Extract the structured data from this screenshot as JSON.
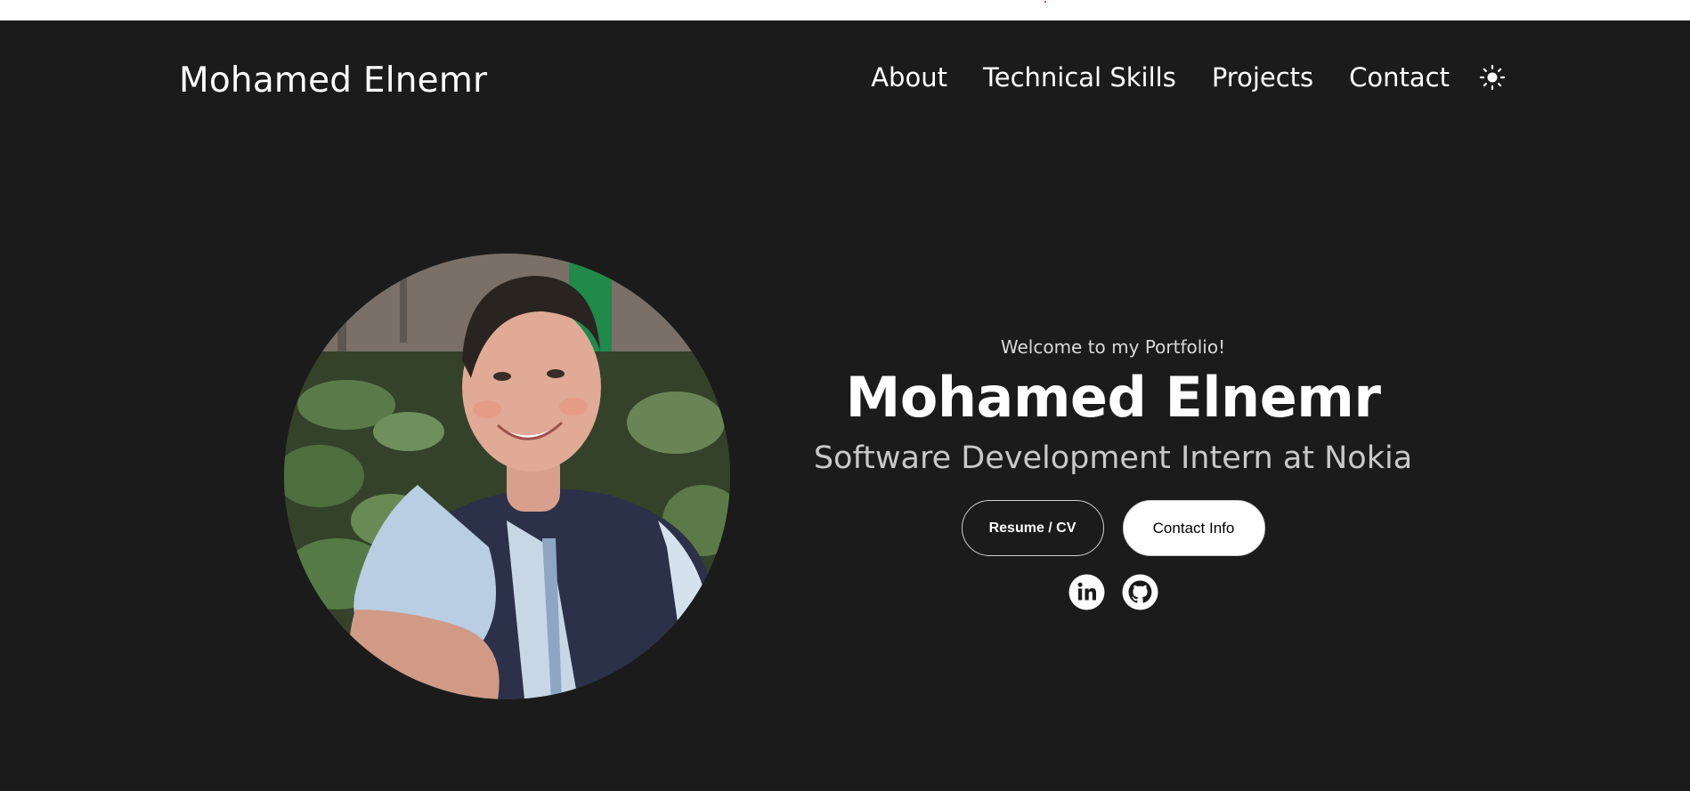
{
  "nav": {
    "logo": "Mohamed Elnemr",
    "links": [
      "About",
      "Technical Skills",
      "Projects",
      "Contact"
    ],
    "theme_toggle_icon": "sun-icon"
  },
  "hero": {
    "photo_alt": "Profile photo",
    "welcome": "Welcome to my Portfolio!",
    "name": "Mohamed Elnemr",
    "role": "Software Development Intern at Nokia",
    "buttons": {
      "resume": "Resume / CV",
      "contact": "Contact Info"
    },
    "socials": [
      "linkedin-icon",
      "github-icon"
    ]
  },
  "colors": {
    "background": "#1b1b1b",
    "text": "#ffffff",
    "muted_text": "#c9c9c9"
  }
}
